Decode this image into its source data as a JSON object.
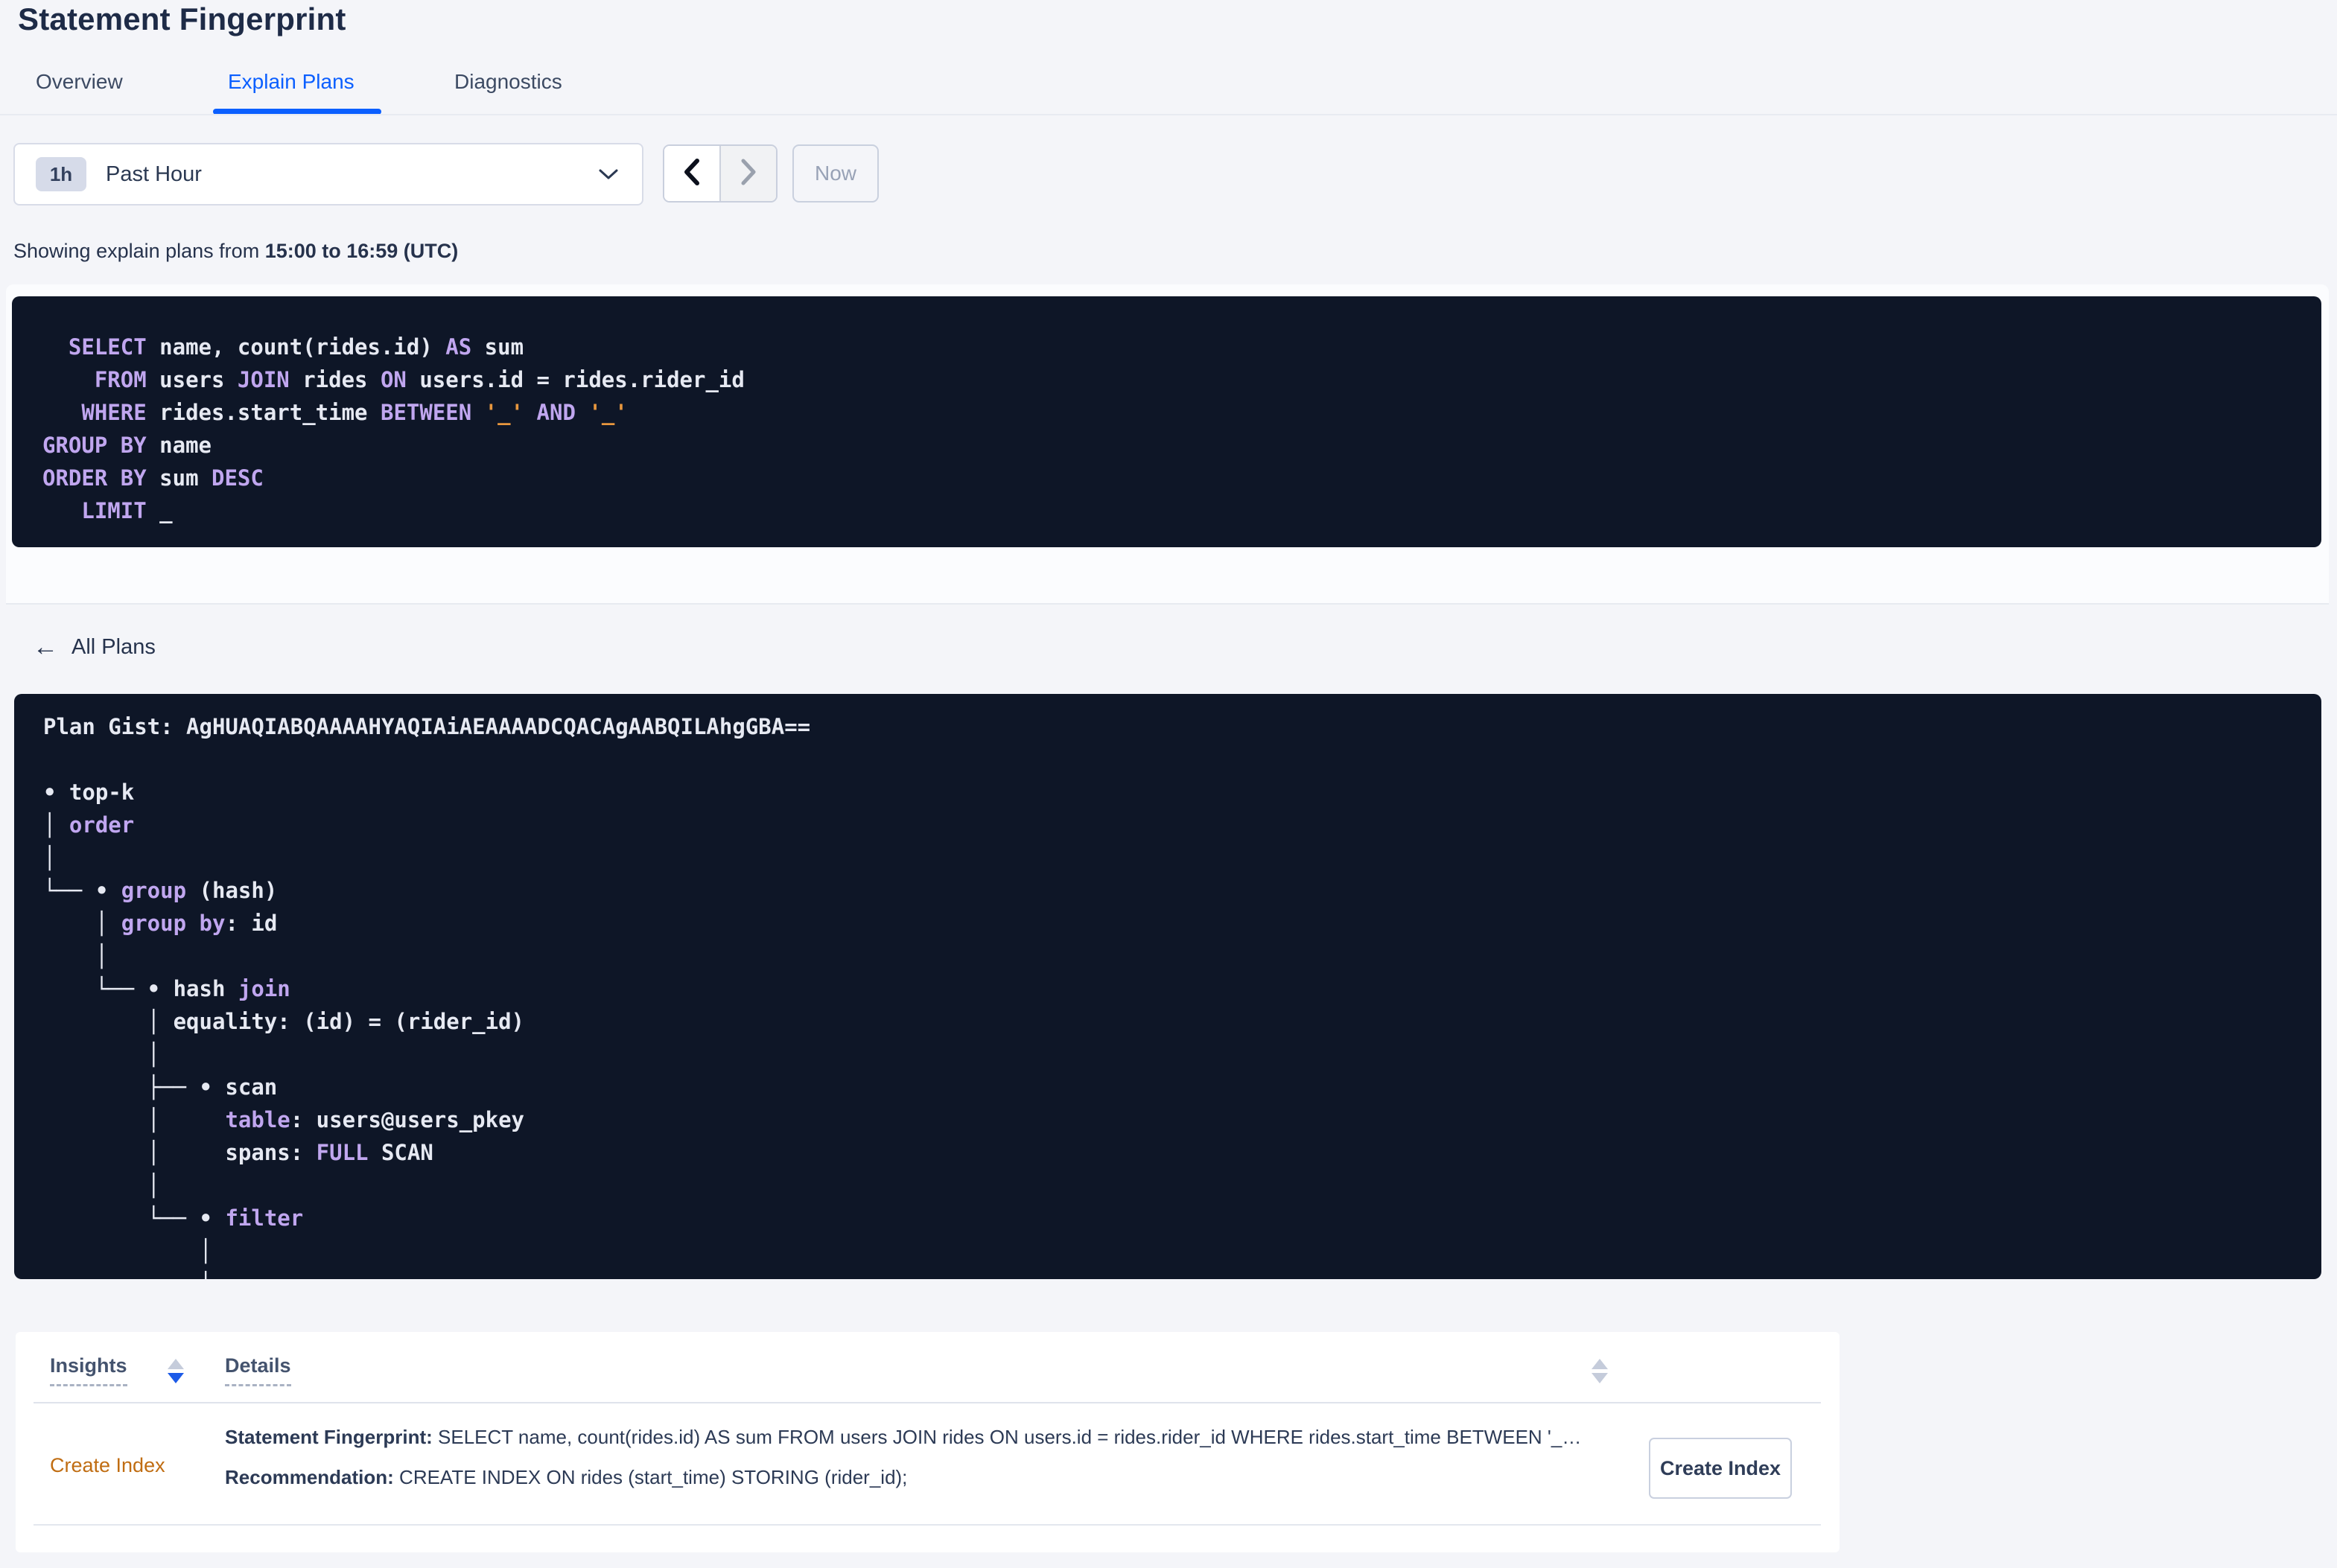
{
  "page": {
    "title": "Statement Fingerprint"
  },
  "tabs": [
    {
      "label": "Overview"
    },
    {
      "label": "Explain Plans"
    },
    {
      "label": "Diagnostics"
    }
  ],
  "time_picker": {
    "badge": "1h",
    "label": "Past Hour",
    "now_label": "Now"
  },
  "showing": {
    "prefix": "Showing explain plans from ",
    "range": "15:00 to 16:59 (UTC)"
  },
  "colors": {
    "accent_blue": "#0b5fff",
    "code_background": "#0e1627",
    "keyword_purple": "#c0a6ef",
    "literal_orange": "#e8973e",
    "link_orange": "#c06d12"
  },
  "sql_lines": [
    [
      {
        "t": "  "
      },
      {
        "t": "SELECT",
        "c": "kw"
      },
      {
        "t": " name, count(rides.id) "
      },
      {
        "t": "AS",
        "c": "kw"
      },
      {
        "t": " sum"
      }
    ],
    [
      {
        "t": "    "
      },
      {
        "t": "FROM",
        "c": "kw"
      },
      {
        "t": " users "
      },
      {
        "t": "JOIN",
        "c": "kw"
      },
      {
        "t": " rides "
      },
      {
        "t": "ON",
        "c": "kw"
      },
      {
        "t": " users.id = rides.rider_id"
      }
    ],
    [
      {
        "t": "   "
      },
      {
        "t": "WHERE",
        "c": "kw"
      },
      {
        "t": " rides.start_time "
      },
      {
        "t": "BETWEEN",
        "c": "kw"
      },
      {
        "t": " "
      },
      {
        "t": "'_'",
        "c": "lit"
      },
      {
        "t": " "
      },
      {
        "t": "AND",
        "c": "kw"
      },
      {
        "t": " "
      },
      {
        "t": "'_'",
        "c": "lit"
      }
    ],
    [
      {
        "t": "GROUP BY",
        "c": "kw"
      },
      {
        "t": " name"
      }
    ],
    [
      {
        "t": "ORDER BY",
        "c": "kw"
      },
      {
        "t": " sum "
      },
      {
        "t": "DESC",
        "c": "kw"
      }
    ],
    [
      {
        "t": "   "
      },
      {
        "t": "LIMIT",
        "c": "kw"
      },
      {
        "t": " _"
      }
    ]
  ],
  "all_plans": {
    "arrow": "←",
    "label": "All Plans"
  },
  "plan_lines": [
    [
      {
        "t": "Plan Gist: AgHUAQIABQAAAAHYAQIAiAEAAAADCQACAgAABQILAhgGBA=="
      }
    ],
    [
      {
        "t": ""
      }
    ],
    [
      {
        "t": "• top-k"
      }
    ],
    [
      {
        "t": "│ "
      },
      {
        "t": "order",
        "c": "kw"
      }
    ],
    [
      {
        "t": "│"
      }
    ],
    [
      {
        "t": "└── • "
      },
      {
        "t": "group",
        "c": "kw"
      },
      {
        "t": " (hash)"
      }
    ],
    [
      {
        "t": "    │ "
      },
      {
        "t": "group by",
        "c": "kw"
      },
      {
        "t": ": id"
      }
    ],
    [
      {
        "t": "    │"
      }
    ],
    [
      {
        "t": "    └── • hash "
      },
      {
        "t": "join",
        "c": "kw"
      }
    ],
    [
      {
        "t": "        │ equality: (id) = (rider_id)"
      }
    ],
    [
      {
        "t": "        │"
      }
    ],
    [
      {
        "t": "        ├── • scan"
      }
    ],
    [
      {
        "t": "        │     "
      },
      {
        "t": "table",
        "c": "kw"
      },
      {
        "t": ": users@users_pkey"
      }
    ],
    [
      {
        "t": "        │     spans: "
      },
      {
        "t": "FULL",
        "c": "kw"
      },
      {
        "t": " SCAN"
      }
    ],
    [
      {
        "t": "        │"
      }
    ],
    [
      {
        "t": "        └── • "
      },
      {
        "t": "filter",
        "c": "kw"
      }
    ],
    [
      {
        "t": "            │"
      }
    ],
    [
      {
        "t": "            │"
      }
    ]
  ],
  "insights_table": {
    "headers": {
      "insights": "Insights",
      "details": "Details"
    },
    "row": {
      "insight_type": "Create Index",
      "fingerprint_label": "Statement Fingerprint:",
      "fingerprint_text": " SELECT name, count(rides.id) AS sum FROM users JOIN rides ON users.id = rides.rider_id WHERE rides.start_time BETWEEN '_…",
      "recommendation_label": "Recommendation:",
      "recommendation_text": " CREATE INDEX ON rides (start_time) STORING (rider_id);",
      "action_label": "Create Index"
    }
  }
}
